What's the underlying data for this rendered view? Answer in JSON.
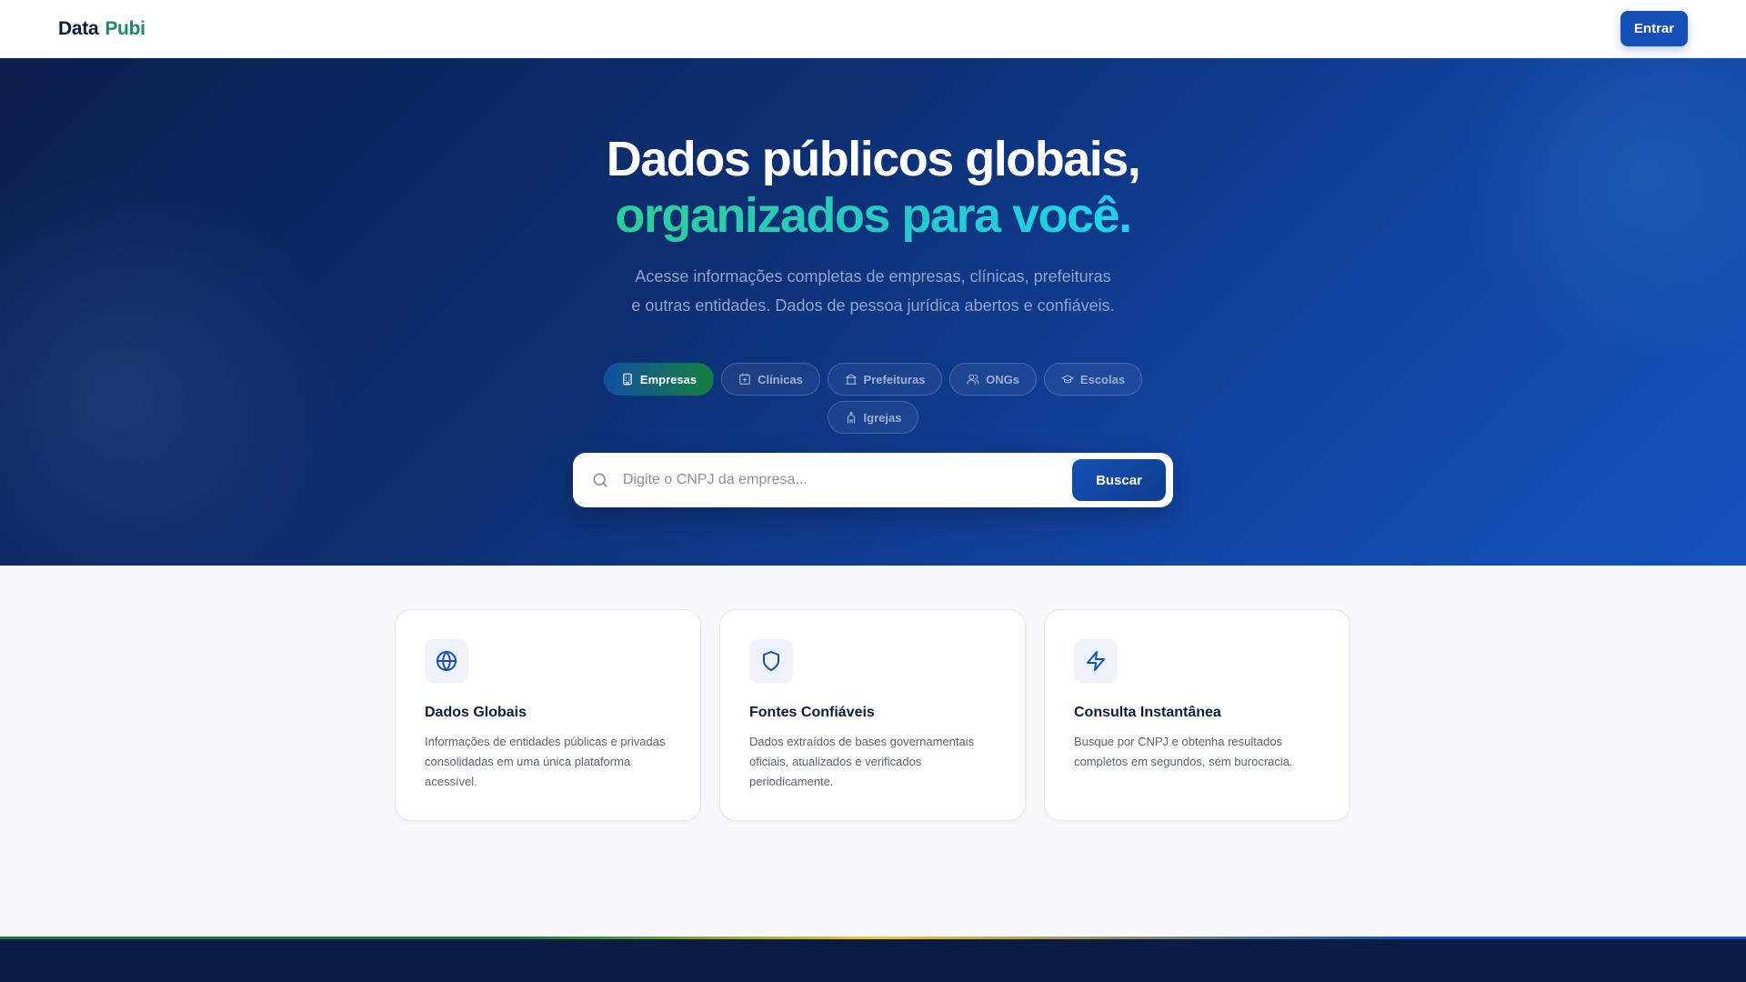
{
  "header": {
    "logo_part1": "Data",
    "logo_part2": "Pubi",
    "login_label": "Entrar"
  },
  "hero": {
    "title_line1": "Dados públicos globais,",
    "title_line2": "organizados para você.",
    "subtitle_line1": "Acesse informações completas de empresas, clínicas, prefeituras",
    "subtitle_line2": "e outras entidades. Dados de pessoa jurídica abertos e confiáveis.",
    "categories": [
      {
        "label": "Empresas",
        "icon": "building-icon",
        "active": true
      },
      {
        "label": "Clínicas",
        "icon": "clinic-icon",
        "active": false
      },
      {
        "label": "Prefeituras",
        "icon": "landmark-icon",
        "active": false
      },
      {
        "label": "ONGs",
        "icon": "users-icon",
        "active": false
      },
      {
        "label": "Escolas",
        "icon": "graduation-cap-icon",
        "active": false
      },
      {
        "label": "Igrejas",
        "icon": "church-icon",
        "active": false
      }
    ],
    "search": {
      "placeholder": "Digite o CNPJ da empresa...",
      "value": "",
      "button_label": "Buscar"
    }
  },
  "features": [
    {
      "icon": "globe-icon",
      "title": "Dados Globais",
      "description": "Informações de entidades públicas e privadas consolidadas em uma única plataforma acessível."
    },
    {
      "icon": "shield-icon",
      "title": "Fontes Confiáveis",
      "description": "Dados extraídos de bases governamentais oficiais, atualizados e verificados periodicamente."
    },
    {
      "icon": "lightning-icon",
      "title": "Consulta Instantânea",
      "description": "Busque por CNPJ e obtenha resultados completos em segundos, sem burocracia."
    }
  ],
  "colors": {
    "brand_blue": "#1550b8",
    "brand_green": "#1a8a6a",
    "accent_teal": "#22d3ee",
    "hero_dark": "#0b1f4d",
    "footer_bg": "#0b1c44"
  }
}
